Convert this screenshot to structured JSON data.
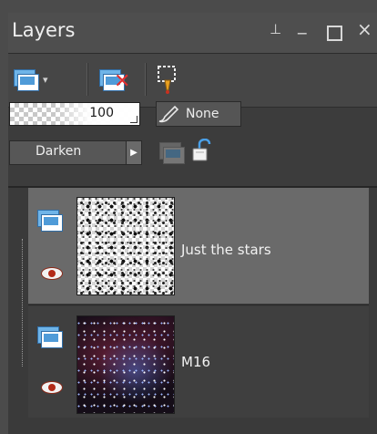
{
  "panel": {
    "title": "Layers",
    "window_buttons": {
      "pin": "ㅁ",
      "minimize": "_",
      "close": "×"
    }
  },
  "toolbar": {
    "new_layer_icon": "new-layer-icon",
    "dropdown_glyph": "▾",
    "delete_icon": "delete-layer-icon",
    "mask_icon": "mask-brush-icon"
  },
  "properties": {
    "opacity": "100",
    "mask_label": "None",
    "blend_mode": "Darken",
    "blend_arrow": "▶"
  },
  "layers": [
    {
      "name": "Just the stars",
      "visible": true,
      "selected": true
    },
    {
      "name": "M16",
      "visible": true,
      "selected": false
    }
  ],
  "colors": {
    "panel_bg": "#3e3e3e",
    "selected_row": "#6a6a6a",
    "layer_icon_blue": "#4f9bd8",
    "delete_red": "#e03030"
  }
}
